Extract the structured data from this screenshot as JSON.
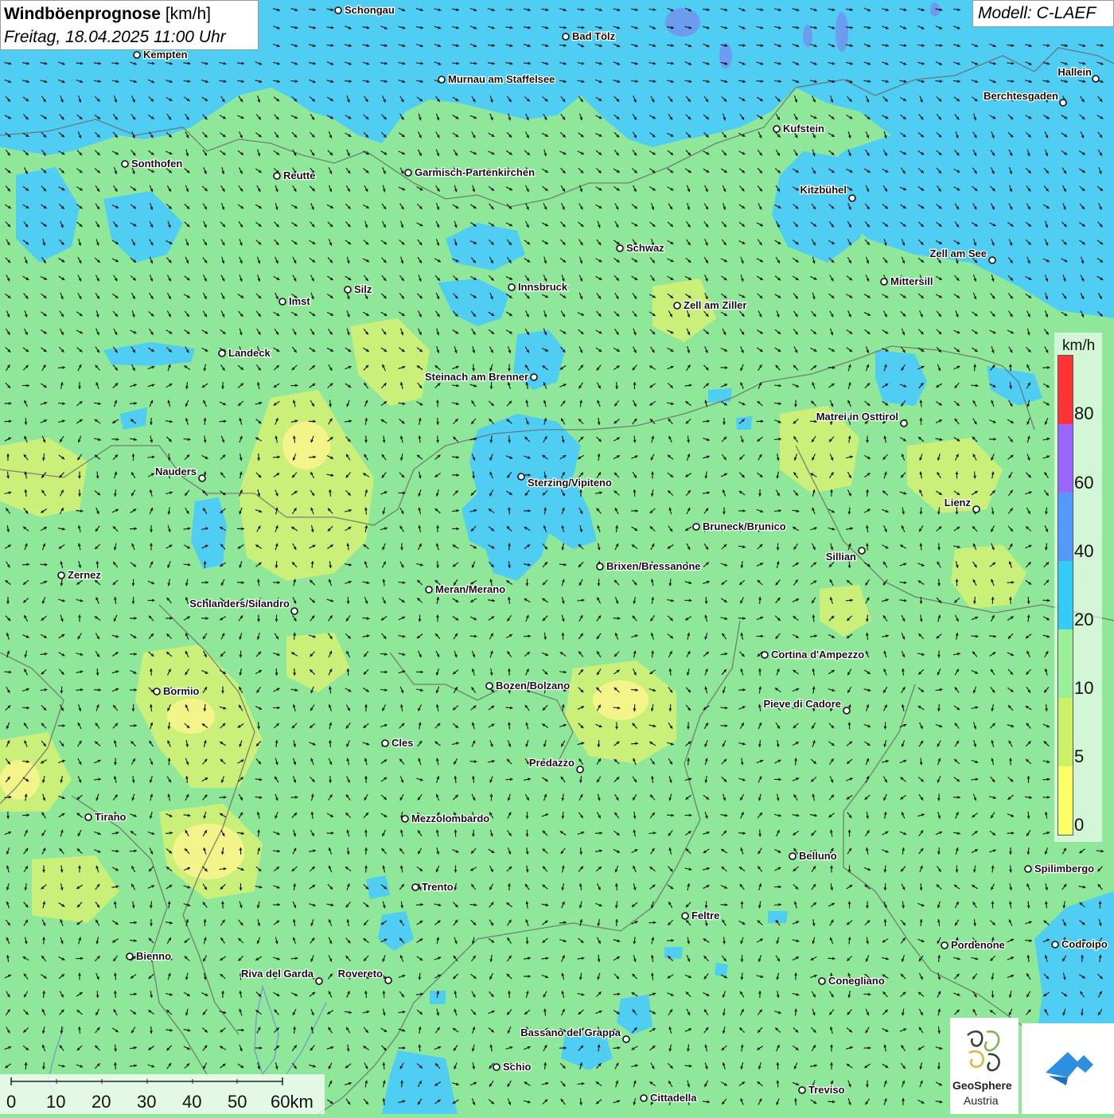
{
  "title": {
    "main": "Windböenprognose",
    "unit": "[km/h]",
    "datetime": "Freitag, 18.04.2025 11:00 Uhr"
  },
  "model": "Modell: C-LAEF",
  "legend": {
    "unit": "km/h",
    "ticks": [
      "80",
      "60",
      "40",
      "20",
      "10",
      "5",
      "0"
    ],
    "colors": [
      "#ff3333",
      "#9966ff",
      "#5599ff",
      "#33ccf5",
      "#99f099",
      "#ccf066",
      "#ffff66"
    ]
  },
  "scale_bar": {
    "labels": [
      "0",
      "10",
      "20",
      "30",
      "40",
      "50",
      "60km"
    ]
  },
  "logo": {
    "name": "GeoSphere",
    "country": "Austria"
  },
  "cities": [
    {
      "name": "Schongau"
    },
    {
      "name": "Bad Tölz"
    },
    {
      "name": "Kempten"
    },
    {
      "name": "Murnau am Staffelsee"
    },
    {
      "name": "Hallein"
    },
    {
      "name": "Berchtesgaden"
    },
    {
      "name": "Kufstein"
    },
    {
      "name": "Sonthofen"
    },
    {
      "name": "Reutte"
    },
    {
      "name": "Garmisch-Partenkirchen"
    },
    {
      "name": "Kitzbühel"
    },
    {
      "name": "Schwaz"
    },
    {
      "name": "Zell am See"
    },
    {
      "name": "Mittersill"
    },
    {
      "name": "Silz"
    },
    {
      "name": "Innsbruck"
    },
    {
      "name": "Imst"
    },
    {
      "name": "Zell am Ziller"
    },
    {
      "name": "Landeck"
    },
    {
      "name": "Steinach am Brenner"
    },
    {
      "name": "Matrei in Osttirol"
    },
    {
      "name": "Nauders"
    },
    {
      "name": "Sterzing/Vipiteno"
    },
    {
      "name": "Lienz"
    },
    {
      "name": "Bruneck/Brunico"
    },
    {
      "name": "Sillian"
    },
    {
      "name": "Zernez"
    },
    {
      "name": "Brixen/Bressanone"
    },
    {
      "name": "Meran/Merano"
    },
    {
      "name": "Schlanders/Silandro"
    },
    {
      "name": "Cortina d'Ampezzo"
    },
    {
      "name": "Bozen/Bolzano"
    },
    {
      "name": "Bormio"
    },
    {
      "name": "Pieve di Cadore"
    },
    {
      "name": "Cles"
    },
    {
      "name": "Predazzo"
    },
    {
      "name": "Tirano"
    },
    {
      "name": "Mezzolombardo"
    },
    {
      "name": "Belluno"
    },
    {
      "name": "Spilimbergo"
    },
    {
      "name": "Trento"
    },
    {
      "name": "Feltre"
    },
    {
      "name": "Pordenone"
    },
    {
      "name": "Codroipo"
    },
    {
      "name": "Bienno"
    },
    {
      "name": "Riva del Garda"
    },
    {
      "name": "Rovereto"
    },
    {
      "name": "Conegliano"
    },
    {
      "name": "Bassano del Grappa"
    },
    {
      "name": "Schio"
    },
    {
      "name": "Treviso"
    },
    {
      "name": "Cittadella"
    }
  ]
}
